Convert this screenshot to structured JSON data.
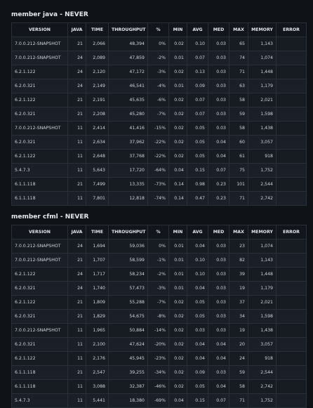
{
  "columns": [
    "VERSION",
    "JAVA",
    "TIME",
    "THROUGHPUT",
    "%",
    "MIN",
    "AVG",
    "MED",
    "MAX",
    "MEMORY",
    "ERROR"
  ],
  "sections": [
    {
      "title": "member java - NEVER",
      "rows": [
        [
          "7.0.0.212-SNAPSHOT",
          "21",
          "2,066",
          "48,394",
          "0%",
          "0.02",
          "0.10",
          "0.03",
          "65",
          "1,143",
          ""
        ],
        [
          "7.0.0.212-SNAPSHOT",
          "24",
          "2,089",
          "47,859",
          "-2%",
          "0.01",
          "0.07",
          "0.03",
          "74",
          "1,074",
          ""
        ],
        [
          "6.2.1.122",
          "24",
          "2,120",
          "47,172",
          "-3%",
          "0.02",
          "0.13",
          "0.03",
          "71",
          "1,448",
          ""
        ],
        [
          "6.2.0.321",
          "24",
          "2,149",
          "46,541",
          "-4%",
          "0.01",
          "0.09",
          "0.03",
          "63",
          "1,179",
          ""
        ],
        [
          "6.2.1.122",
          "21",
          "2,191",
          "45,635",
          "-6%",
          "0.02",
          "0.07",
          "0.03",
          "58",
          "2,021",
          ""
        ],
        [
          "6.2.0.321",
          "21",
          "2,208",
          "45,280",
          "-7%",
          "0.02",
          "0.07",
          "0.03",
          "59",
          "1,598",
          ""
        ],
        [
          "7.0.0.212-SNAPSHOT",
          "11",
          "2,414",
          "41,416",
          "-15%",
          "0.02",
          "0.05",
          "0.03",
          "58",
          "1,438",
          ""
        ],
        [
          "6.2.0.321",
          "11",
          "2,634",
          "37,962",
          "-22%",
          "0.02",
          "0.05",
          "0.04",
          "60",
          "3,057",
          ""
        ],
        [
          "6.2.1.122",
          "11",
          "2,648",
          "37,768",
          "-22%",
          "0.02",
          "0.05",
          "0.04",
          "61",
          "918",
          ""
        ],
        [
          "5.4.7.3",
          "11",
          "5,643",
          "17,720",
          "-64%",
          "0.04",
          "0.15",
          "0.07",
          "75",
          "1,752",
          ""
        ],
        [
          "6.1.1.118",
          "21",
          "7,499",
          "13,335",
          "-73%",
          "0.14",
          "0.98",
          "0.23",
          "101",
          "2,544",
          ""
        ],
        [
          "6.1.1.118",
          "11",
          "7,801",
          "12,818",
          "-74%",
          "0.14",
          "0.47",
          "0.23",
          "71",
          "2,742",
          ""
        ]
      ]
    },
    {
      "title": "member cfml - NEVER",
      "rows": [
        [
          "7.0.0.212-SNAPSHOT",
          "24",
          "1,694",
          "59,036",
          "0%",
          "0.01",
          "0.04",
          "0.03",
          "23",
          "1,074",
          ""
        ],
        [
          "7.0.0.212-SNAPSHOT",
          "21",
          "1,707",
          "58,599",
          "-1%",
          "0.01",
          "0.10",
          "0.03",
          "82",
          "1,143",
          ""
        ],
        [
          "6.2.1.122",
          "24",
          "1,717",
          "58,234",
          "-2%",
          "0.01",
          "0.10",
          "0.03",
          "39",
          "1,448",
          ""
        ],
        [
          "6.2.0.321",
          "24",
          "1,740",
          "57,473",
          "-3%",
          "0.01",
          "0.04",
          "0.03",
          "19",
          "1,179",
          ""
        ],
        [
          "6.2.1.122",
          "21",
          "1,809",
          "55,288",
          "-7%",
          "0.02",
          "0.05",
          "0.03",
          "37",
          "2,021",
          ""
        ],
        [
          "6.2.0.321",
          "21",
          "1,829",
          "54,675",
          "-8%",
          "0.02",
          "0.05",
          "0.03",
          "34",
          "1,598",
          ""
        ],
        [
          "7.0.0.212-SNAPSHOT",
          "11",
          "1,965",
          "50,884",
          "-14%",
          "0.02",
          "0.03",
          "0.03",
          "19",
          "1,438",
          ""
        ],
        [
          "6.2.0.321",
          "11",
          "2,100",
          "47,624",
          "-20%",
          "0.02",
          "0.04",
          "0.04",
          "20",
          "3,057",
          ""
        ],
        [
          "6.2.1.122",
          "11",
          "2,176",
          "45,945",
          "-23%",
          "0.02",
          "0.04",
          "0.04",
          "24",
          "918",
          ""
        ],
        [
          "6.1.1.118",
          "21",
          "2,547",
          "39,255",
          "-34%",
          "0.02",
          "0.09",
          "0.03",
          "59",
          "2,544",
          ""
        ],
        [
          "6.1.1.118",
          "11",
          "3,088",
          "32,387",
          "-46%",
          "0.02",
          "0.05",
          "0.04",
          "58",
          "2,742",
          ""
        ],
        [
          "5.4.7.3",
          "11",
          "5,441",
          "18,380",
          "-69%",
          "0.04",
          "0.15",
          "0.07",
          "71",
          "1,752",
          ""
        ]
      ]
    }
  ]
}
